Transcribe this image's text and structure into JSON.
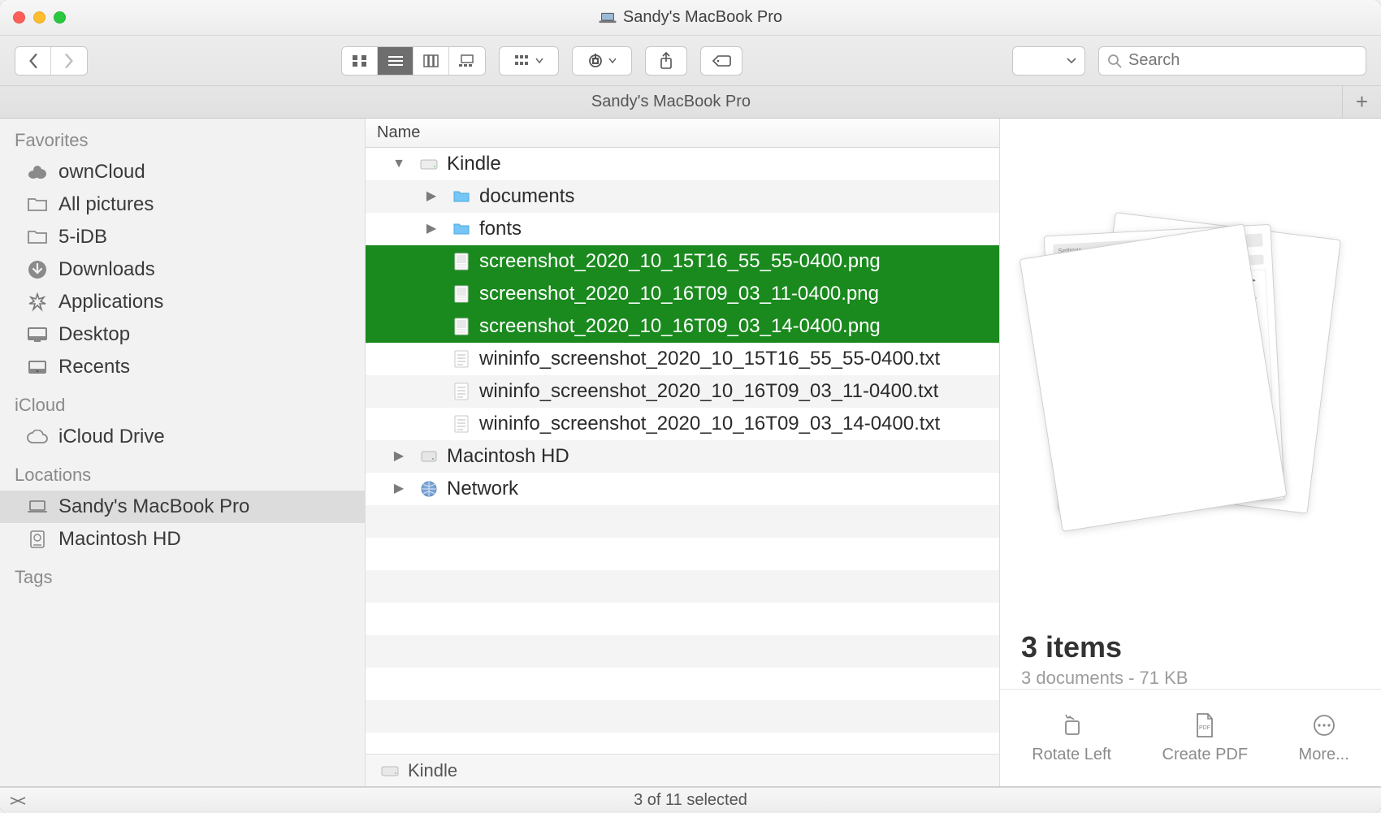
{
  "window": {
    "title": "Sandy's MacBook Pro",
    "tab_title": "Sandy's MacBook Pro"
  },
  "toolbar": {
    "search_placeholder": "Search"
  },
  "sidebar": {
    "sections": {
      "favorites": {
        "label": "Favorites"
      },
      "icloud": {
        "label": "iCloud"
      },
      "locations": {
        "label": "Locations"
      },
      "tags": {
        "label": "Tags"
      }
    },
    "favorites": [
      {
        "label": "ownCloud",
        "icon": "owncloud"
      },
      {
        "label": "All pictures",
        "icon": "folder"
      },
      {
        "label": "5-iDB",
        "icon": "folder"
      },
      {
        "label": "Downloads",
        "icon": "download"
      },
      {
        "label": "Applications",
        "icon": "apps"
      },
      {
        "label": "Desktop",
        "icon": "desktop"
      },
      {
        "label": "Recents",
        "icon": "recents"
      }
    ],
    "icloud_items": [
      {
        "label": "iCloud Drive",
        "icon": "cloud"
      }
    ],
    "locations": [
      {
        "label": "Sandy's MacBook Pro",
        "icon": "laptop",
        "selected": true
      },
      {
        "label": "Macintosh HD",
        "icon": "hdd"
      }
    ]
  },
  "columns": {
    "name": "Name"
  },
  "files": [
    {
      "indent": 0,
      "expanded": true,
      "icon": "drive",
      "label": "Kindle",
      "sel": false
    },
    {
      "indent": 1,
      "expanded": false,
      "icon": "folder",
      "label": "documents",
      "sel": false
    },
    {
      "indent": 1,
      "expanded": false,
      "icon": "folder",
      "label": "fonts",
      "sel": false
    },
    {
      "indent": 1,
      "expanded": null,
      "icon": "image",
      "label": "screenshot_2020_10_15T16_55_55-0400.png",
      "sel": true
    },
    {
      "indent": 1,
      "expanded": null,
      "icon": "image",
      "label": "screenshot_2020_10_16T09_03_11-0400.png",
      "sel": true
    },
    {
      "indent": 1,
      "expanded": null,
      "icon": "image",
      "label": "screenshot_2020_10_16T09_03_14-0400.png",
      "sel": true
    },
    {
      "indent": 1,
      "expanded": null,
      "icon": "txt",
      "label": "wininfo_screenshot_2020_10_15T16_55_55-0400.txt",
      "sel": false
    },
    {
      "indent": 1,
      "expanded": null,
      "icon": "txt",
      "label": "wininfo_screenshot_2020_10_16T09_03_11-0400.txt",
      "sel": false
    },
    {
      "indent": 1,
      "expanded": null,
      "icon": "txt",
      "label": "wininfo_screenshot_2020_10_16T09_03_14-0400.txt",
      "sel": false
    },
    {
      "indent": 0,
      "expanded": false,
      "icon": "hdd",
      "label": "Macintosh HD",
      "sel": false
    },
    {
      "indent": 0,
      "expanded": false,
      "icon": "network",
      "label": "Network",
      "sel": false
    }
  ],
  "pathbar": {
    "label": "Kindle"
  },
  "preview": {
    "count_label": "3 items",
    "subtitle": "3 documents - 71 KB"
  },
  "quick_actions": {
    "rotate": "Rotate Left",
    "pdf": "Create PDF",
    "more": "More..."
  },
  "status": {
    "text": "3 of 11 selected"
  }
}
